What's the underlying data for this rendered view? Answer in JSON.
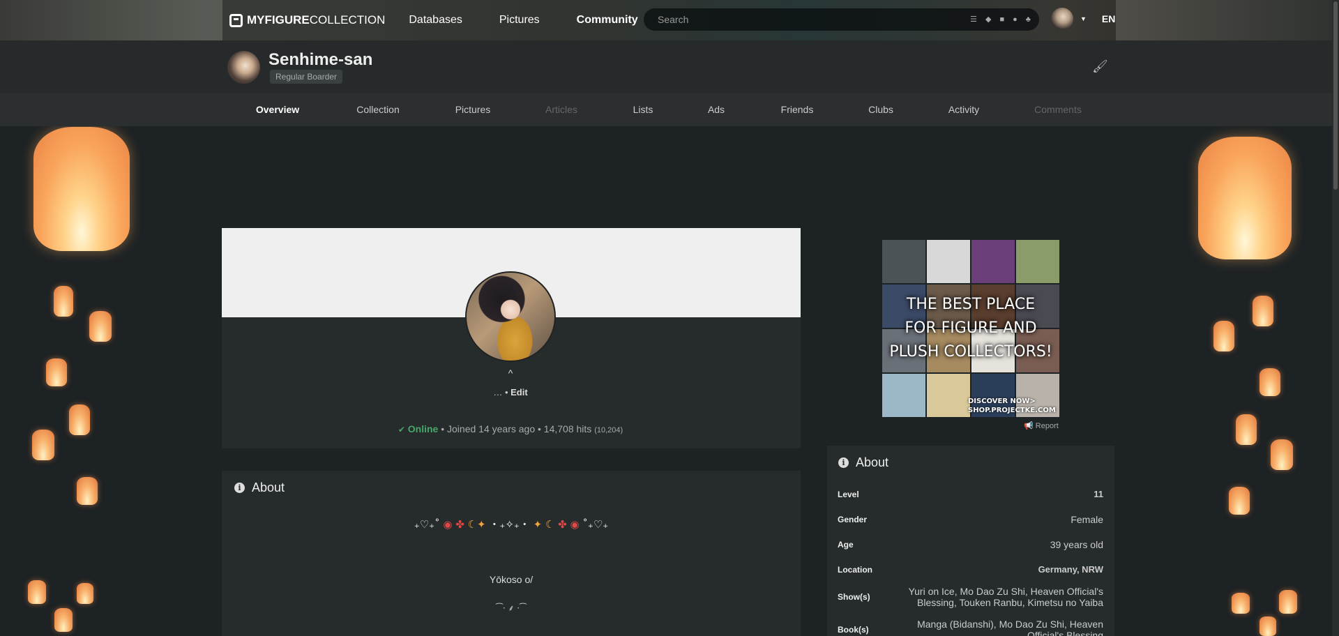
{
  "nav": {
    "brand_bold": "MYFIGURE",
    "brand_light": "COLLECTION",
    "links": [
      "Databases",
      "Pictures",
      "Community"
    ],
    "search_placeholder": "Search",
    "language": "EN"
  },
  "profile": {
    "username": "Senhime-san",
    "rank": "Regular Boarder"
  },
  "tabs": [
    {
      "label": "Overview",
      "state": "active"
    },
    {
      "label": "Collection",
      "state": "normal"
    },
    {
      "label": "Pictures",
      "state": "normal"
    },
    {
      "label": "Articles",
      "state": "disabled"
    },
    {
      "label": "Lists",
      "state": "normal"
    },
    {
      "label": "Ads",
      "state": "normal"
    },
    {
      "label": "Friends",
      "state": "normal"
    },
    {
      "label": "Clubs",
      "state": "normal"
    },
    {
      "label": "Activity",
      "state": "normal"
    },
    {
      "label": "Comments",
      "state": "disabled"
    }
  ],
  "card": {
    "chevron": "^",
    "ellipsis": "…",
    "edit": "Edit",
    "status_online": "Online",
    "status_rest": " • Joined 14 years ago • 14,708 hits ",
    "hits_detail": "(10,204)"
  },
  "about_main": {
    "title": "About",
    "greeting": "Yōkoso o/"
  },
  "ad": {
    "headline_1": "THE BEST PLACE",
    "headline_2": "FOR FIGURE AND",
    "headline_3": "PLUSH COLLECTORS!",
    "cta_1": "DISCOVER NOW>",
    "cta_2": "SHOP.PROJECTKE.COM",
    "report": "Report"
  },
  "about_side": {
    "title": "About",
    "rows": [
      {
        "key": "Level",
        "value": "11"
      },
      {
        "key": "Gender",
        "value": "Female"
      },
      {
        "key": "Age",
        "value": "39 years old"
      },
      {
        "key": "Location",
        "value": "Germany, NRW"
      },
      {
        "key": "Show(s)",
        "value": "Yuri on Ice, Mo Dao Zu Shi, Heaven Official's Blessing, Touken Ranbu, Kimetsu no Yaiba"
      },
      {
        "key": "Book(s)",
        "value": "Manga (Bidanshi), Mo Dao Zu Shi, Heaven Official's Blessing"
      }
    ]
  },
  "colors": {
    "online": "#46a86a",
    "background": "#1d2224",
    "panel": "#262b2c",
    "banner": "#efefef"
  },
  "icons": [
    "logo-icon",
    "search-icon",
    "list-icon",
    "tag-icon",
    "box-icon",
    "user-icon",
    "group-icon",
    "brush-icon",
    "info-icon",
    "megaphone-icon",
    "check-circle-icon"
  ]
}
